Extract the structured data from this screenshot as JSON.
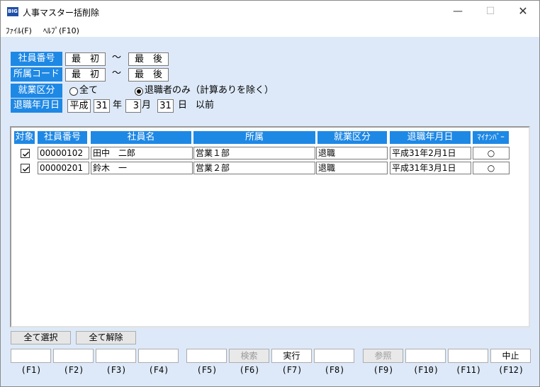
{
  "window": {
    "icon_text": "BIG",
    "title": "人事マスター括削除",
    "min_glyph": "—",
    "max_glyph": "☐",
    "close_glyph": "✕"
  },
  "menu": {
    "file": "ﾌｧｲﾙ(F)",
    "help": "ﾍﾙﾌﾟ(F10)"
  },
  "criteria": {
    "emp_no_label": "社員番号",
    "emp_no_from": "最　初",
    "emp_no_to": "最　後",
    "dept_label": "所属コード",
    "dept_from": "最　初",
    "dept_to": "最　後",
    "tilde": "～",
    "work_label": "就業区分",
    "radio_all": "全て",
    "radio_retired": "退職者のみ（計算ありを除く）",
    "retire_label": "退職年月日",
    "era": "平成",
    "year": "31",
    "year_unit": "年",
    "month": "3",
    "month_unit": "月",
    "day": "31",
    "day_unit": "日",
    "before": "以前"
  },
  "table": {
    "headers": [
      "対象",
      "社員番号",
      "社員名",
      "所属",
      "就業区分",
      "退職年月日",
      "ﾏｲﾅﾝﾊﾞｰ"
    ],
    "rows": [
      {
        "checked": true,
        "emp_no": "00000102",
        "name": "田中　二郎",
        "dept": "営業１部",
        "work": "退職",
        "retire_date": "平成31年2月1日",
        "mynumber": "○"
      },
      {
        "checked": true,
        "emp_no": "00000201",
        "name": "鈴木　一",
        "dept": "営業２部",
        "work": "退職",
        "retire_date": "平成31年3月1日",
        "mynumber": "○"
      }
    ]
  },
  "buttons": {
    "select_all": "全て選択",
    "deselect_all": "全て解除"
  },
  "fkeys": {
    "labels": [
      "",
      "",
      "",
      "",
      "",
      "検索",
      "実行",
      "",
      "参照",
      "",
      "",
      "中止"
    ],
    "keys": [
      "(F1)",
      "(F2)",
      "(F3)",
      "(F4)",
      "(F5)",
      "(F6)",
      "(F7)",
      "(F8)",
      "(F9)",
      "(F10)",
      "(F11)",
      "(F12)"
    ]
  },
  "colors": {
    "accent": "#1e88e5",
    "window_bg": "#dde9f8"
  }
}
